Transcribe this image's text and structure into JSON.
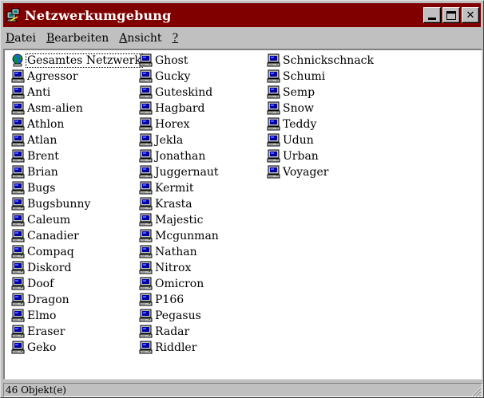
{
  "window": {
    "title": "Netzwerkumgebung",
    "title_bar_color": "#800000"
  },
  "menu": [
    {
      "accel": "D",
      "rest": "atei"
    },
    {
      "accel": "B",
      "rest": "earbeiten"
    },
    {
      "accel": "A",
      "rest": "nsicht"
    },
    {
      "accel": "?",
      "rest": ""
    }
  ],
  "items": [
    {
      "label": "Gesamtes Netzwerk",
      "icon": "globe-network-icon"
    },
    {
      "label": "Agressor",
      "icon": "computer-icon"
    },
    {
      "label": "Anti",
      "icon": "computer-icon"
    },
    {
      "label": "Asm-alien",
      "icon": "computer-icon"
    },
    {
      "label": "Athlon",
      "icon": "computer-icon"
    },
    {
      "label": "Atlan",
      "icon": "computer-icon"
    },
    {
      "label": "Brent",
      "icon": "computer-icon"
    },
    {
      "label": "Brian",
      "icon": "computer-icon"
    },
    {
      "label": "Bugs",
      "icon": "computer-icon"
    },
    {
      "label": "Bugsbunny",
      "icon": "computer-icon"
    },
    {
      "label": "Caleum",
      "icon": "computer-icon"
    },
    {
      "label": "Canadier",
      "icon": "computer-icon"
    },
    {
      "label": "Compaq",
      "icon": "computer-icon"
    },
    {
      "label": "Diskord",
      "icon": "computer-icon"
    },
    {
      "label": "Doof",
      "icon": "computer-icon"
    },
    {
      "label": "Dragon",
      "icon": "computer-icon"
    },
    {
      "label": "Elmo",
      "icon": "computer-icon"
    },
    {
      "label": "Eraser",
      "icon": "computer-icon"
    },
    {
      "label": "Geko",
      "icon": "computer-icon"
    },
    {
      "label": "Ghost",
      "icon": "computer-icon"
    },
    {
      "label": "Gucky",
      "icon": "computer-icon"
    },
    {
      "label": "Guteskind",
      "icon": "computer-icon"
    },
    {
      "label": "Hagbard",
      "icon": "computer-icon"
    },
    {
      "label": "Horex",
      "icon": "computer-icon"
    },
    {
      "label": "Jekla",
      "icon": "computer-icon"
    },
    {
      "label": "Jonathan",
      "icon": "computer-icon"
    },
    {
      "label": "Juggernaut",
      "icon": "computer-icon"
    },
    {
      "label": "Kermit",
      "icon": "computer-icon"
    },
    {
      "label": "Krasta",
      "icon": "computer-icon"
    },
    {
      "label": "Majestic",
      "icon": "computer-icon"
    },
    {
      "label": "Mcgunman",
      "icon": "computer-icon"
    },
    {
      "label": "Nathan",
      "icon": "computer-icon"
    },
    {
      "label": "Nitrox",
      "icon": "computer-icon"
    },
    {
      "label": "Omicron",
      "icon": "computer-icon"
    },
    {
      "label": "P166",
      "icon": "computer-icon"
    },
    {
      "label": "Pegasus",
      "icon": "computer-icon"
    },
    {
      "label": "Radar",
      "icon": "computer-icon"
    },
    {
      "label": "Riddler",
      "icon": "computer-icon"
    },
    {
      "label": "Schnickschnack",
      "icon": "computer-icon"
    },
    {
      "label": "Schumi",
      "icon": "computer-icon"
    },
    {
      "label": "Semp",
      "icon": "computer-icon"
    },
    {
      "label": "Snow",
      "icon": "computer-icon"
    },
    {
      "label": "Teddy",
      "icon": "computer-icon"
    },
    {
      "label": "Udun",
      "icon": "computer-icon"
    },
    {
      "label": "Urban",
      "icon": "computer-icon"
    },
    {
      "label": "Voyager",
      "icon": "computer-icon"
    }
  ],
  "status": {
    "text": "46 Objekt(e)"
  }
}
